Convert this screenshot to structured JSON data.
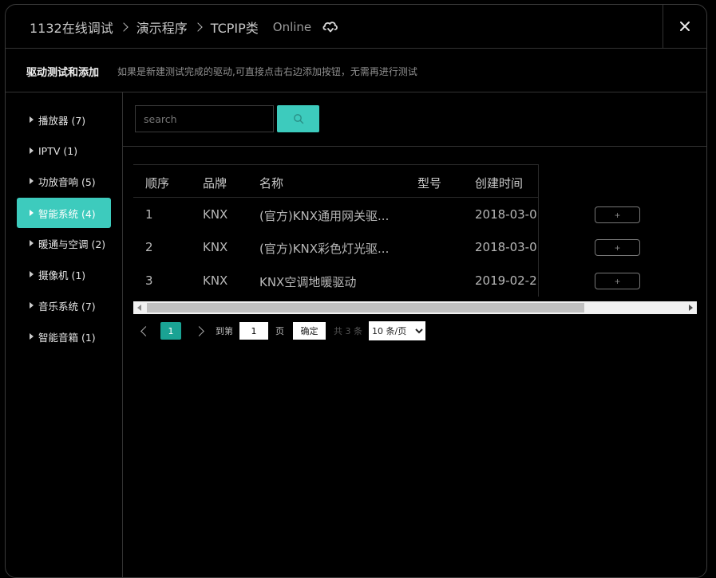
{
  "header": {
    "crumbs": [
      "1132在线调试",
      "演示程序",
      "TCPIP类"
    ],
    "status": "Online",
    "close_label": "✕"
  },
  "subheader": {
    "title": "驱动测试和添加",
    "hint": "如果是新建测试完成的驱动,可直接点击右边添加按钮，无需再进行测试"
  },
  "sidebar": {
    "items": [
      {
        "label": "播放器 (7)",
        "active": false
      },
      {
        "label": "IPTV (1)",
        "active": false
      },
      {
        "label": "功放音响 (5)",
        "active": false
      },
      {
        "label": "智能系统 (4)",
        "active": true
      },
      {
        "label": "暖通与空调 (2)",
        "active": false
      },
      {
        "label": "摄像机 (1)",
        "active": false
      },
      {
        "label": "音乐系统 (7)",
        "active": false
      },
      {
        "label": "智能音箱 (1)",
        "active": false
      }
    ]
  },
  "search": {
    "placeholder": "search",
    "value": ""
  },
  "table": {
    "columns": [
      "顺序",
      "品牌",
      "名称",
      "型号",
      "创建时间"
    ],
    "rows": [
      {
        "index": "1",
        "brand": "KNX",
        "name": "(官方)KNX通用网关驱...",
        "model": "",
        "created": "2018-03-0",
        "action": "+"
      },
      {
        "index": "2",
        "brand": "KNX",
        "name": "(官方)KNX彩色灯光驱...",
        "model": "",
        "created": "2018-03-0",
        "action": "+"
      },
      {
        "index": "3",
        "brand": "KNX",
        "name": "KNX空调地暖驱动",
        "model": "",
        "created": "2019-02-2",
        "action": "+"
      }
    ]
  },
  "pagination": {
    "current": "1",
    "goto_label": "到第",
    "goto_value": "1",
    "page_label": "页",
    "confirm_label": "确定",
    "total_label": "共 3 条",
    "page_size": "10 条/页"
  },
  "colors": {
    "accent": "#3dcbbd",
    "page_active": "#1aa394"
  }
}
